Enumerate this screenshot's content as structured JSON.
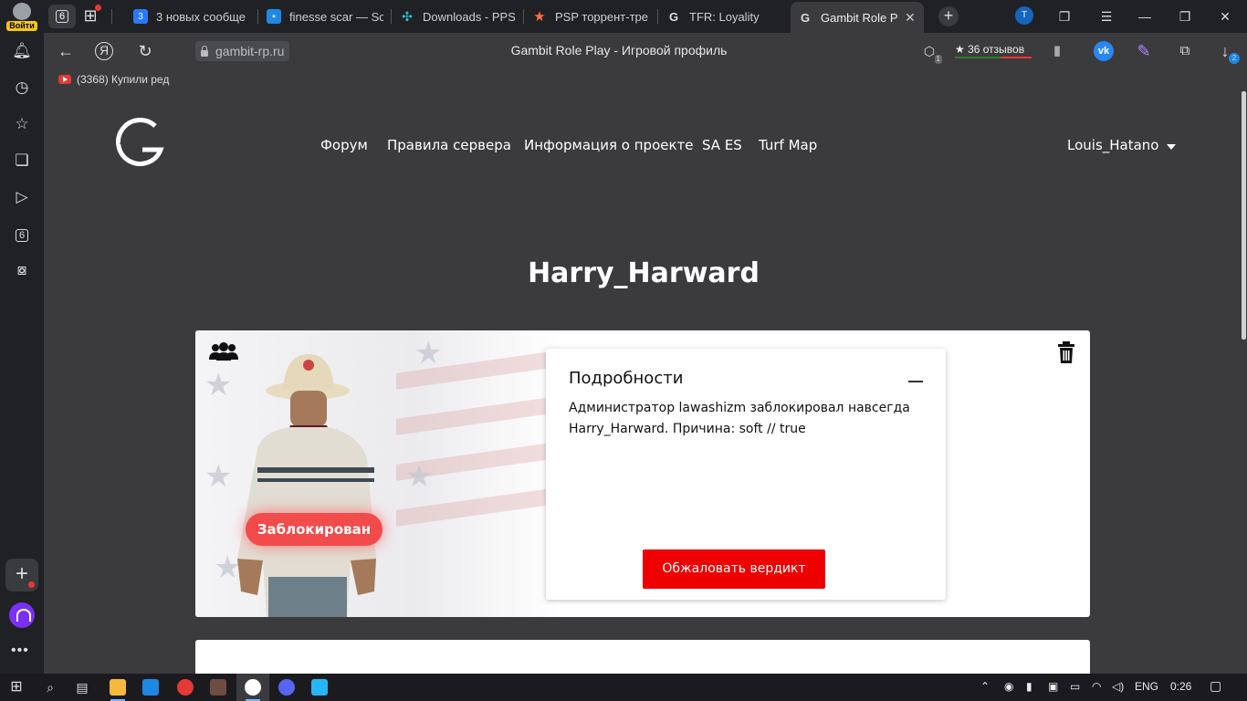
{
  "browser": {
    "profile_label": "Войти",
    "tab_count": "6",
    "tabs": [
      {
        "title": "3 новых сообще",
        "icon_text": "3",
        "color": "#2979ff"
      },
      {
        "title": "finesse scar — Sc",
        "icon_text": "",
        "color": "#1e88e5"
      },
      {
        "title": "Downloads - PPSS",
        "icon_text": "",
        "color": "#26c6da"
      },
      {
        "title": "PSP торрент-тре",
        "icon_text": "★",
        "color": "#ff7043"
      },
      {
        "title": "TFR: Loyality",
        "icon_text": "G",
        "color": "#202124"
      },
      {
        "title": "Gambit Role Pl",
        "icon_text": "G",
        "color": "#3b3b3e"
      }
    ],
    "url": "gambit-rp.ru",
    "page_title": "Gambit Role Play - Игровой профиль",
    "reviews": "36 отзывов",
    "ext_badge": "1",
    "downloads_badge": "2",
    "bookmark": "(3368) Купили ред"
  },
  "sidebar": {
    "tab_count": "6"
  },
  "site": {
    "nav": [
      "Форум",
      "Правила сервера",
      "Информация о проекте",
      "SA ES",
      "Turf Map"
    ],
    "user": "Louis_Hatano",
    "player_name": "Harry_Harward",
    "status_badge": "Заблокирован",
    "details_title": "Подробности",
    "details_text": "Администратор lawashizm заблокировал навсегда Harry_Harward. Причина: soft // true",
    "appeal_button": "Обжаловать вердикт",
    "accent": "#ee0000"
  },
  "taskbar": {
    "lang": "ENG",
    "time": "0:26"
  }
}
